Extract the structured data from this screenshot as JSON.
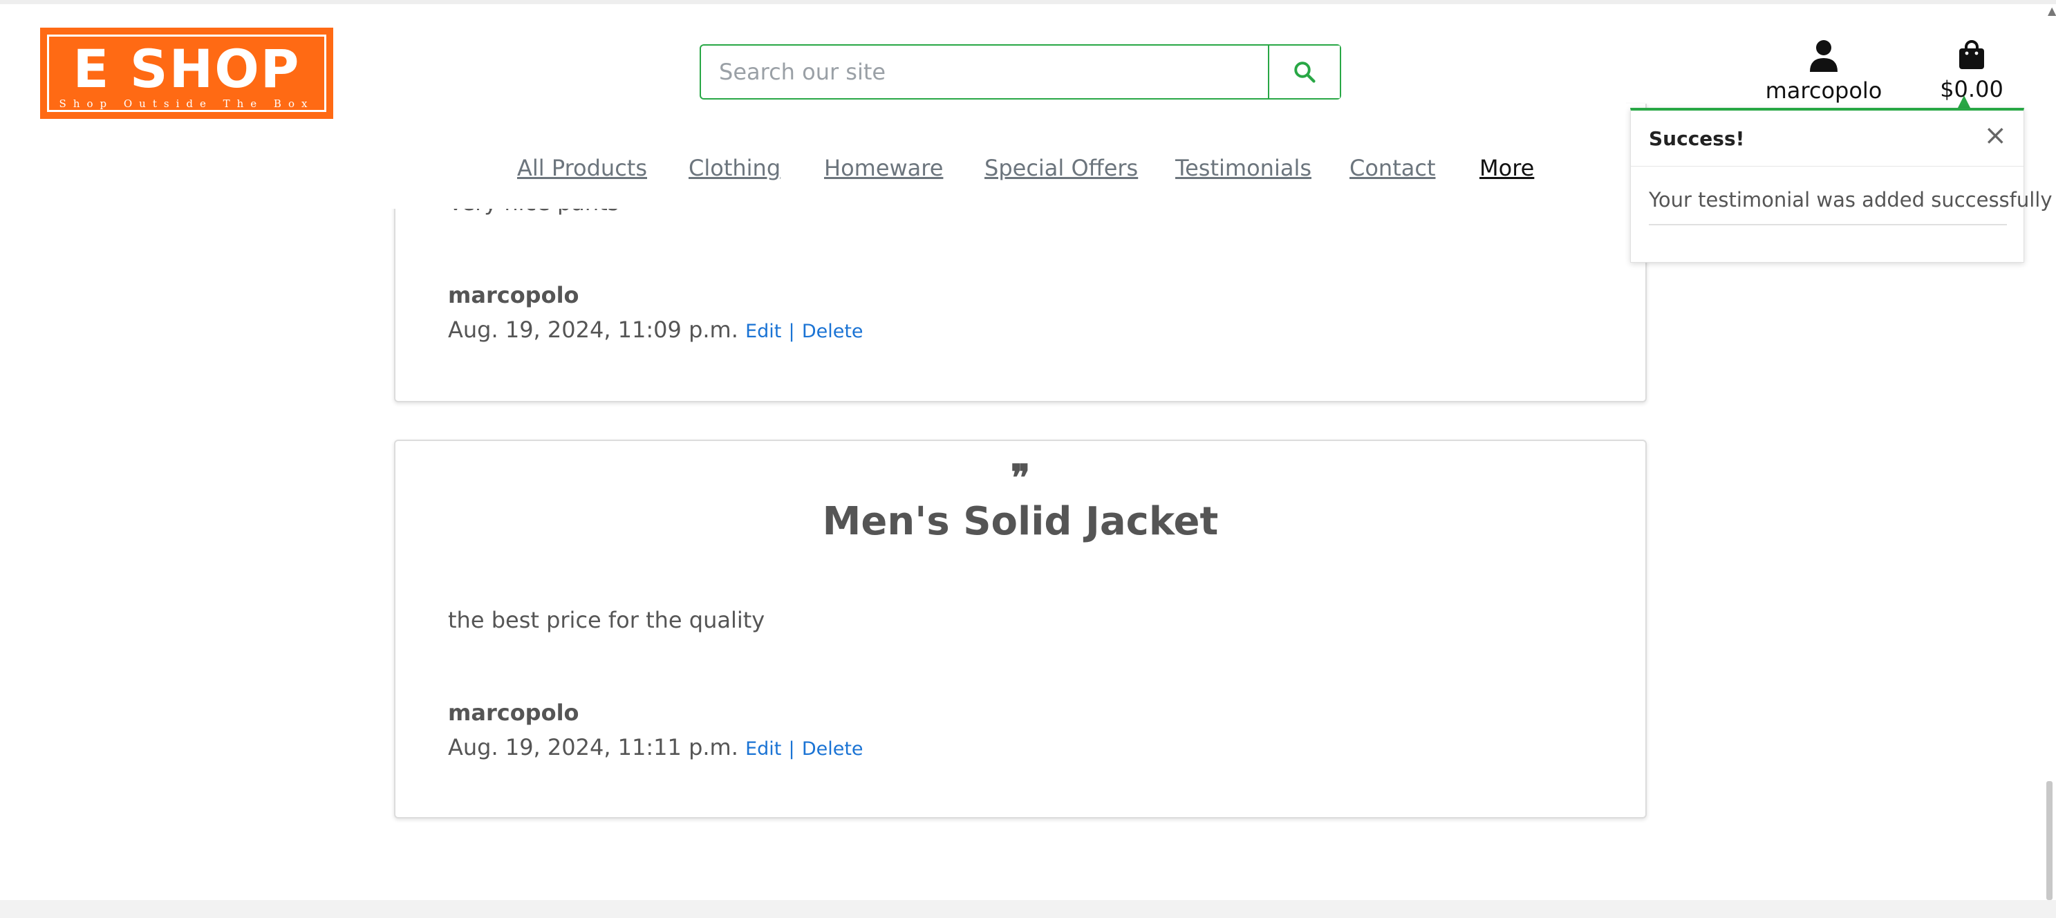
{
  "brand": {
    "name": "E SHOP",
    "tagline": "Shop Outside The Box",
    "color": "#ff6a14"
  },
  "search": {
    "placeholder": "Search our site",
    "value": "",
    "icon": "search-icon"
  },
  "account": {
    "label": "marcopolo",
    "icon": "user-icon"
  },
  "bag": {
    "total": "$0.00",
    "icon": "shopping-bag-icon"
  },
  "nav": {
    "items": [
      "All Products",
      "Clothing",
      "Homeware",
      "Special Offers",
      "Testimonials",
      "Contact",
      "More"
    ]
  },
  "toast": {
    "title": "Success!",
    "close": "×",
    "message": "Your testimonial was added successfully",
    "accent": "#28a745"
  },
  "testimonials": [
    {
      "title": "",
      "body": "Very nice pants",
      "user": "marcopolo",
      "date": "Aug. 19, 2024, 11:09 p.m.",
      "edit": "Edit",
      "sep": "|",
      "delete": "Delete"
    },
    {
      "quote": "❞",
      "title": "Men's Solid Jacket",
      "body": "the best price for the quality",
      "user": "marcopolo",
      "date": "Aug. 19, 2024, 11:11 p.m.",
      "edit": "Edit",
      "sep": "|",
      "delete": "Delete"
    }
  ]
}
